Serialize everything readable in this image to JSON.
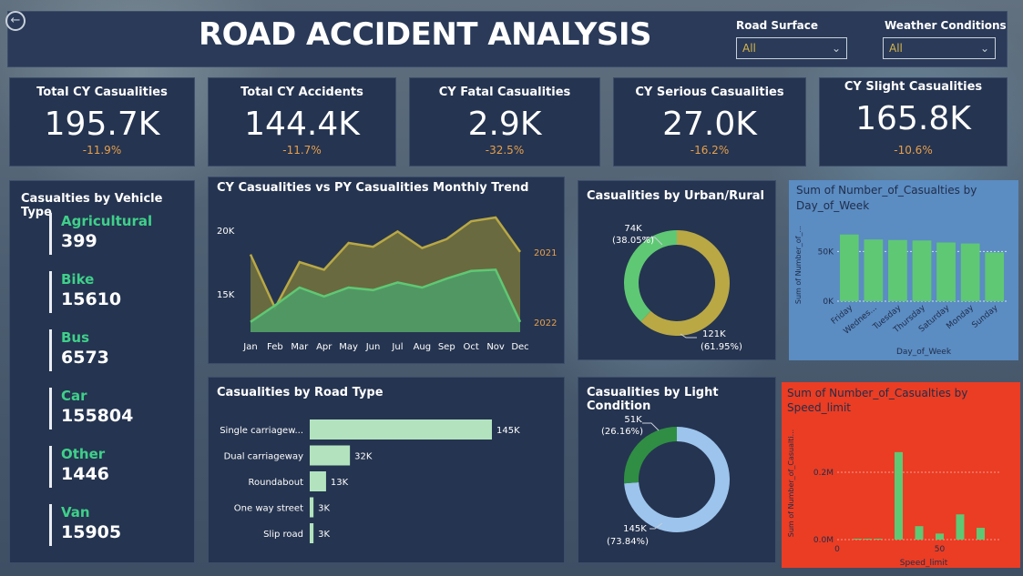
{
  "header": {
    "title": "ROAD ACCIDENT ANALYSIS",
    "back_icon": "back-arrow-icon",
    "road_surface_label": "Road Surface",
    "road_surface_value": "All",
    "weather_label": "Weather Conditions",
    "weather_value": "All"
  },
  "kpis": [
    {
      "title": "Total CY Casualities",
      "value": "195.7K",
      "delta": "-11.9%"
    },
    {
      "title": "Total CY Accidents",
      "value": "144.4K",
      "delta": "-11.7%"
    },
    {
      "title": "CY Fatal Casualities",
      "value": "2.9K",
      "delta": "-32.5%"
    },
    {
      "title": "CY Serious Casualities",
      "value": "27.0K",
      "delta": "-16.2%"
    },
    {
      "title": "CY Slight Casualities",
      "value": "165.8K",
      "delta": "-10.6%"
    }
  ],
  "vehicle": {
    "title": "Casualties by Vehicle Type",
    "items": [
      {
        "name": "Agricultural",
        "value": "399"
      },
      {
        "name": "Bike",
        "value": "15610"
      },
      {
        "name": "Bus",
        "value": "6573"
      },
      {
        "name": "Car",
        "value": "155804"
      },
      {
        "name": "Other",
        "value": "1446"
      },
      {
        "name": "Van",
        "value": "15905"
      }
    ]
  },
  "colors": {
    "green": "#5fc874",
    "olive": "#b9a844",
    "light_green": "#b2e3be",
    "light_blue": "#9cc4ec",
    "dark_green": "#2f8e43",
    "accent_orange": "#e7a04c",
    "red_panel": "#ea3d24",
    "blue_panel": "#5b8cc2"
  },
  "chart_data": [
    {
      "type": "area",
      "title": "CY Casualities vs PY Casualities Monthly Trend",
      "categories": [
        "Jan",
        "Feb",
        "Mar",
        "Apr",
        "May",
        "Jun",
        "Jul",
        "Aug",
        "Sep",
        "Oct",
        "Nov",
        "Dec"
      ],
      "yticks": [
        "20K",
        "15K"
      ],
      "ylim": [
        12000,
        22000
      ],
      "series": [
        {
          "name": "2021",
          "values": [
            18100,
            13900,
            17500,
            16900,
            19000,
            18700,
            19900,
            18600,
            19300,
            20700,
            21000,
            18300
          ]
        },
        {
          "name": "2022",
          "values": [
            12800,
            14100,
            15500,
            14800,
            15500,
            15300,
            15900,
            15500,
            16200,
            16800,
            16900,
            12800
          ]
        }
      ]
    },
    {
      "type": "pie",
      "title": "Casualities by Urban/Rural",
      "labels": [
        {
          "value": "74K",
          "pct": "(38.05%)"
        },
        {
          "value": "121K",
          "pct": "(61.95%)"
        }
      ],
      "values": [
        38.05,
        61.95
      ]
    },
    {
      "type": "bar",
      "title": "Sum of Number_of_Casualties by Day_of_Week",
      "categories": [
        "Friday",
        "Wednes...",
        "Tuesday",
        "Thursday",
        "Saturday",
        "Monday",
        "Sunday"
      ],
      "values": [
        67000,
        62000,
        61500,
        61000,
        59000,
        58000,
        49000
      ],
      "xlabel": "Day_of_Week",
      "ylabel": "Sum of Number_of_...",
      "yticks": [
        "50K",
        "0K"
      ],
      "ylim": [
        0,
        75000
      ]
    },
    {
      "type": "bar",
      "title": "Casualities by Road Type",
      "categories": [
        "Single carriagew...",
        "Dual carriageway",
        "Roundabout",
        "One way street",
        "Slip road"
      ],
      "values": [
        145,
        32,
        13,
        3,
        3
      ],
      "data_labels": [
        "145K",
        "32K",
        "13K",
        "3K",
        "3K"
      ]
    },
    {
      "type": "pie",
      "title": "Casualities by Light Condition",
      "labels": [
        {
          "value": "51K",
          "pct": "(26.16%)"
        },
        {
          "value": "145K",
          "pct": "(73.84%)"
        }
      ],
      "values": [
        26.16,
        73.84
      ]
    },
    {
      "type": "bar",
      "title": "Sum of Number_of_Casualties by Speed_limit",
      "x": [
        10,
        15,
        20,
        30,
        40,
        50,
        60,
        70
      ],
      "values": [
        300,
        200,
        1500,
        260000,
        40000,
        18000,
        75000,
        35000
      ],
      "xticks": [
        "0",
        "50"
      ],
      "yticks": [
        "0.2M",
        "0.0M"
      ],
      "xlabel": "Speed_limit",
      "ylabel": "Sum of Number_of_Casualti...",
      "ylim": [
        0,
        330000
      ],
      "xlim": [
        0,
        80
      ]
    }
  ]
}
